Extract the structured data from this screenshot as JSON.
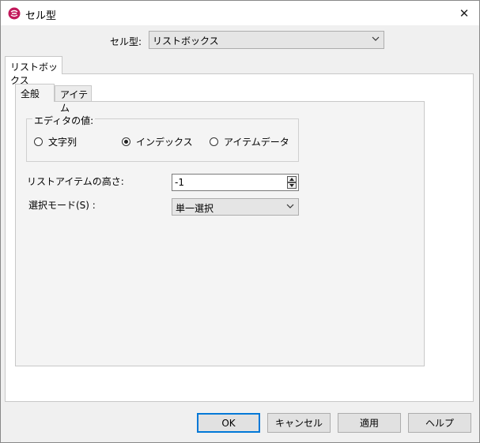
{
  "window": {
    "title": "セル型",
    "close_glyph": "✕"
  },
  "celltype": {
    "label": "セル型:",
    "value": "リストボックス"
  },
  "outer_tab": {
    "label": "リストボックス"
  },
  "inner_tabs": [
    {
      "label": "全般"
    },
    {
      "label": "アイテム"
    }
  ],
  "editor_value": {
    "group_label": "エディタの値:",
    "options": [
      {
        "label": "文字列",
        "selected": false
      },
      {
        "label": "インデックス",
        "selected": true
      },
      {
        "label": "アイテムデータ",
        "selected": false
      }
    ]
  },
  "list_item_height": {
    "label": "リストアイテムの高さ:",
    "value": "-1"
  },
  "selection_mode": {
    "label": "選択モード(S) :",
    "value": "単一選択"
  },
  "buttons": {
    "ok": "OK",
    "cancel": "キャンセル",
    "apply": "適用",
    "help": "ヘルプ"
  },
  "colors": {
    "icon": "#c2185b",
    "accent": "#0078d7"
  }
}
